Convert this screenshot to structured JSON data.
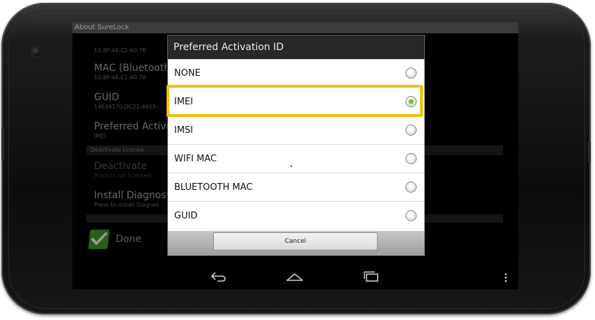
{
  "app_title": "About SureLock",
  "background_list": {
    "items": [
      {
        "subtitle": "10:BF:48:C1:60:7B"
      },
      {
        "title": "MAC (Bluetooth)",
        "subtitle": "10:BF:48:C1:60:7A"
      },
      {
        "title": "GUID",
        "subtitle": "14634170-DC21-4615-"
      },
      {
        "title": "Preferred Activat",
        "subtitle": "IMEI"
      }
    ],
    "section_header": "Deactivate License",
    "deactivate": {
      "title": "Deactivate",
      "subtitle": "Product not licensed"
    },
    "diagnostics": {
      "title": "Install Diagnosti",
      "subtitle": "Press to install Diagnos"
    },
    "done_label": "Done"
  },
  "dialog": {
    "title": "Preferred Activation ID",
    "options": [
      {
        "label": "NONE",
        "selected": false
      },
      {
        "label": "IMEI",
        "selected": true
      },
      {
        "label": "IMSI",
        "selected": false
      },
      {
        "label": "WIFI MAC",
        "selected": false
      },
      {
        "label": "BLUETOOTH MAC",
        "selected": false
      },
      {
        "label": "GUID",
        "selected": false
      }
    ],
    "cancel_label": "Cancel"
  },
  "navbar": {
    "icons": [
      "back-icon",
      "home-icon",
      "recent-apps-icon",
      "menu-overflow-icon"
    ]
  },
  "colors": {
    "highlight": "#f4bf0d",
    "radio_checked": "#6fc22b",
    "done_icon": "#3e8f2a"
  }
}
